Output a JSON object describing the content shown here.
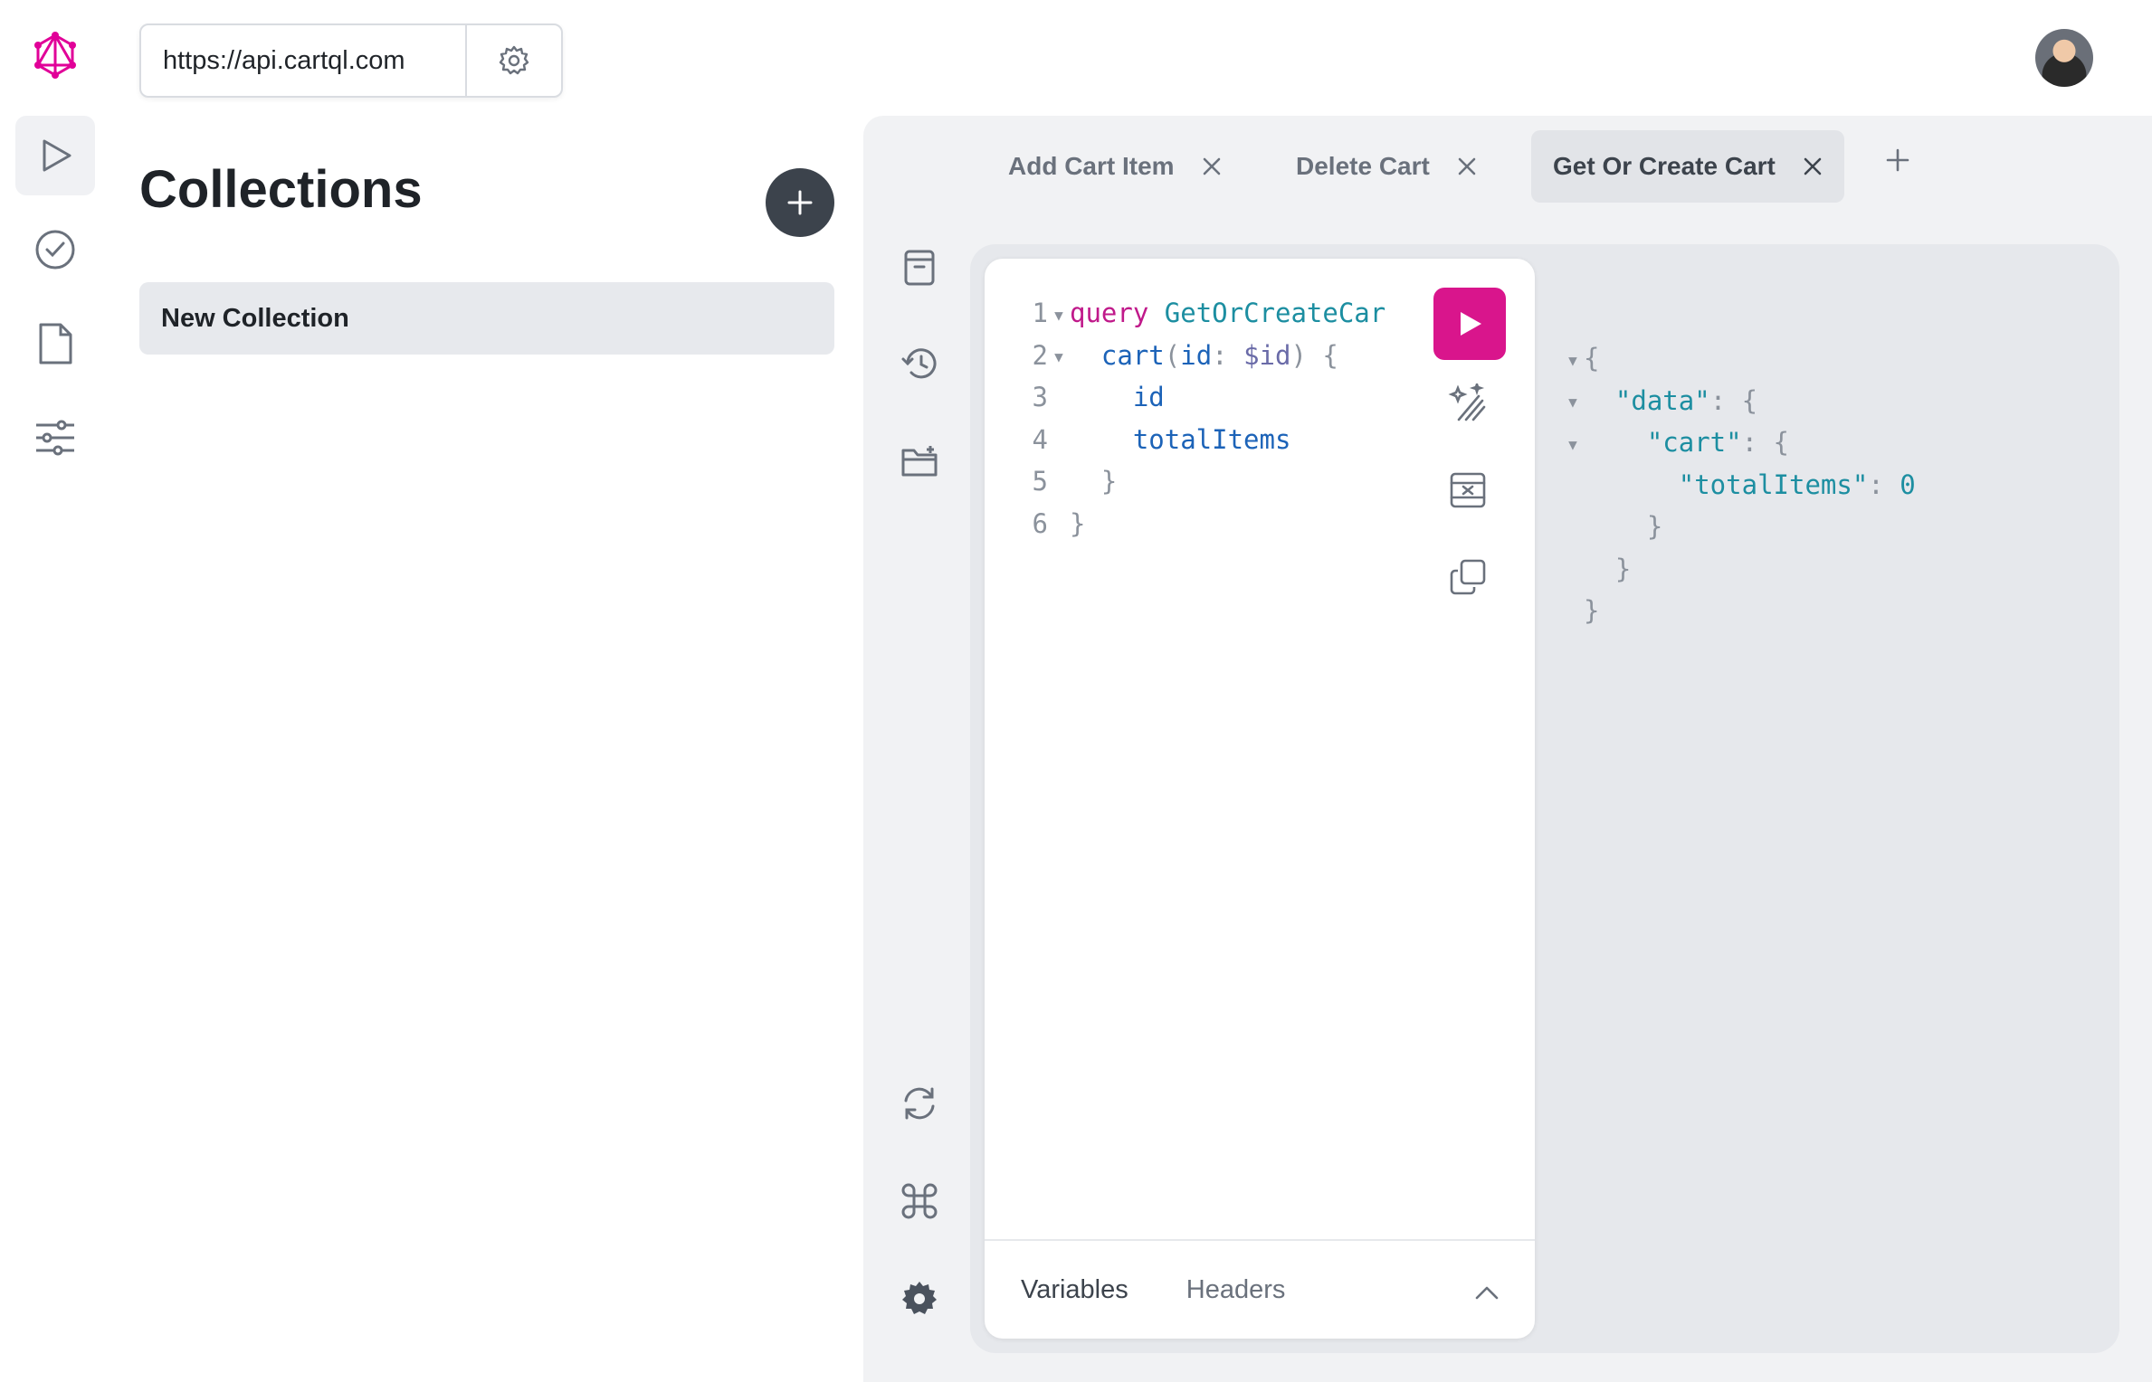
{
  "endpoint": {
    "url": "https://api.cartql.com"
  },
  "collections": {
    "title": "Collections",
    "items": [
      {
        "label": "New Collection"
      }
    ]
  },
  "tabs": [
    {
      "label": "Add Cart Item",
      "active": false
    },
    {
      "label": "Delete Cart",
      "active": false
    },
    {
      "label": "Get Or Create Cart",
      "active": true
    }
  ],
  "editor": {
    "lines": [
      {
        "n": "1",
        "fold": true
      },
      {
        "n": "2",
        "fold": true
      },
      {
        "n": "3",
        "fold": false
      },
      {
        "n": "4",
        "fold": false
      },
      {
        "n": "5",
        "fold": false
      },
      {
        "n": "6",
        "fold": false
      }
    ],
    "tokens": {
      "query_kw": "query",
      "op_name": "GetOrCreateCar",
      "cart_field": "cart",
      "open_paren": "(",
      "arg_name": "id",
      "colon": ":",
      "arg_var": "$id",
      "close_paren_brace": ") {",
      "id_field": "id",
      "total_field": "totalItems",
      "close_brace": "}"
    }
  },
  "footer": {
    "variables_label": "Variables",
    "headers_label": "Headers"
  },
  "result": {
    "open": "{",
    "data_key": "\"data\"",
    "colon": ":",
    "brace_open": "{",
    "cart_key": "\"cart\"",
    "total_key": "\"totalItems\"",
    "total_value": "0",
    "close": "}"
  },
  "colors": {
    "accent": "#d9158c",
    "keyword": "#c0198a",
    "definition": "#1c8ea1",
    "field": "#1c63b8"
  }
}
